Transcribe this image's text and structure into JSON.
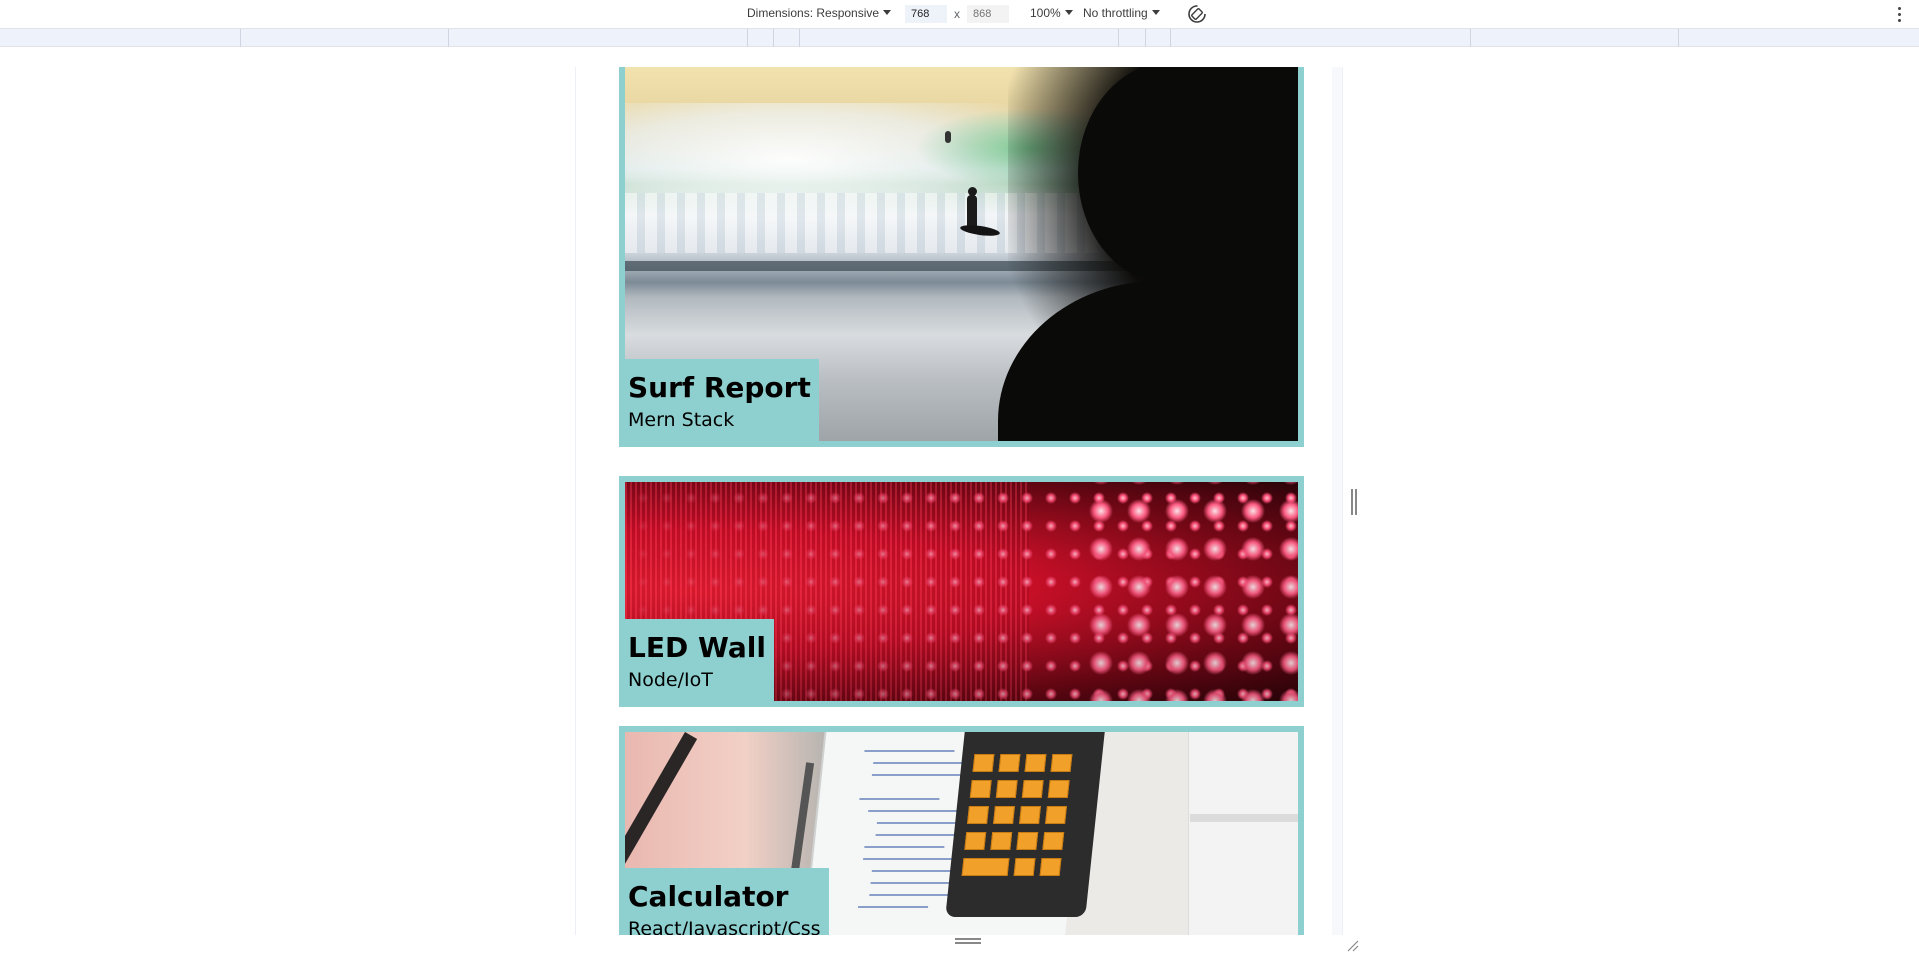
{
  "toolbar": {
    "dimensions_label": "Dimensions: Responsive",
    "width_value": "768",
    "height_value": "868",
    "times_symbol": "x",
    "zoom_label": "100%",
    "throttle_label": "No throttling",
    "icons": {
      "rotate": "rotate-icon",
      "more": "more-vertical-icon",
      "caret": "caret-down-icon"
    }
  },
  "projects": [
    {
      "title": "Surf Report",
      "subtitle": "Mern Stack",
      "image": "surf-photo"
    },
    {
      "title": "LED Wall",
      "subtitle": "Node/IoT",
      "image": "led-wall-photo"
    },
    {
      "title": "Calculator",
      "subtitle": "React/Javascript/Css",
      "image": "calculator-photo"
    }
  ],
  "colors": {
    "card_border": "#8ecfcf",
    "label_background": "#8ecfcf",
    "ruler": "#eef2fa"
  }
}
